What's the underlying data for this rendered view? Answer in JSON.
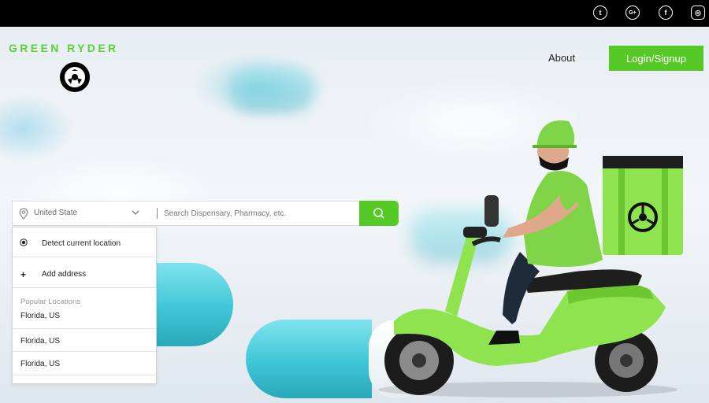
{
  "brand": {
    "name": "GREEN RYDER",
    "accent_color": "#55c925"
  },
  "topbar": {
    "social_icons": [
      "twitter-icon",
      "google-plus-icon",
      "facebook-icon",
      "instagram-icon"
    ],
    "twitter_glyph": "t",
    "google_glyph": "G+",
    "facebook_glyph": "f",
    "instagram_glyph": "◎"
  },
  "nav": {
    "about_label": "About",
    "login_label": "Login/Signup"
  },
  "search": {
    "location_value": "United State",
    "query_placeholder": "Search Dispensary, Pharmacy, etc."
  },
  "dropdown": {
    "detect_label": "Detect current location",
    "add_symbol": "+",
    "add_label": "Add address",
    "section_title": "Popular Locations",
    "locations": [
      "Florida, US",
      "Florida, US",
      "Florida, US"
    ]
  }
}
